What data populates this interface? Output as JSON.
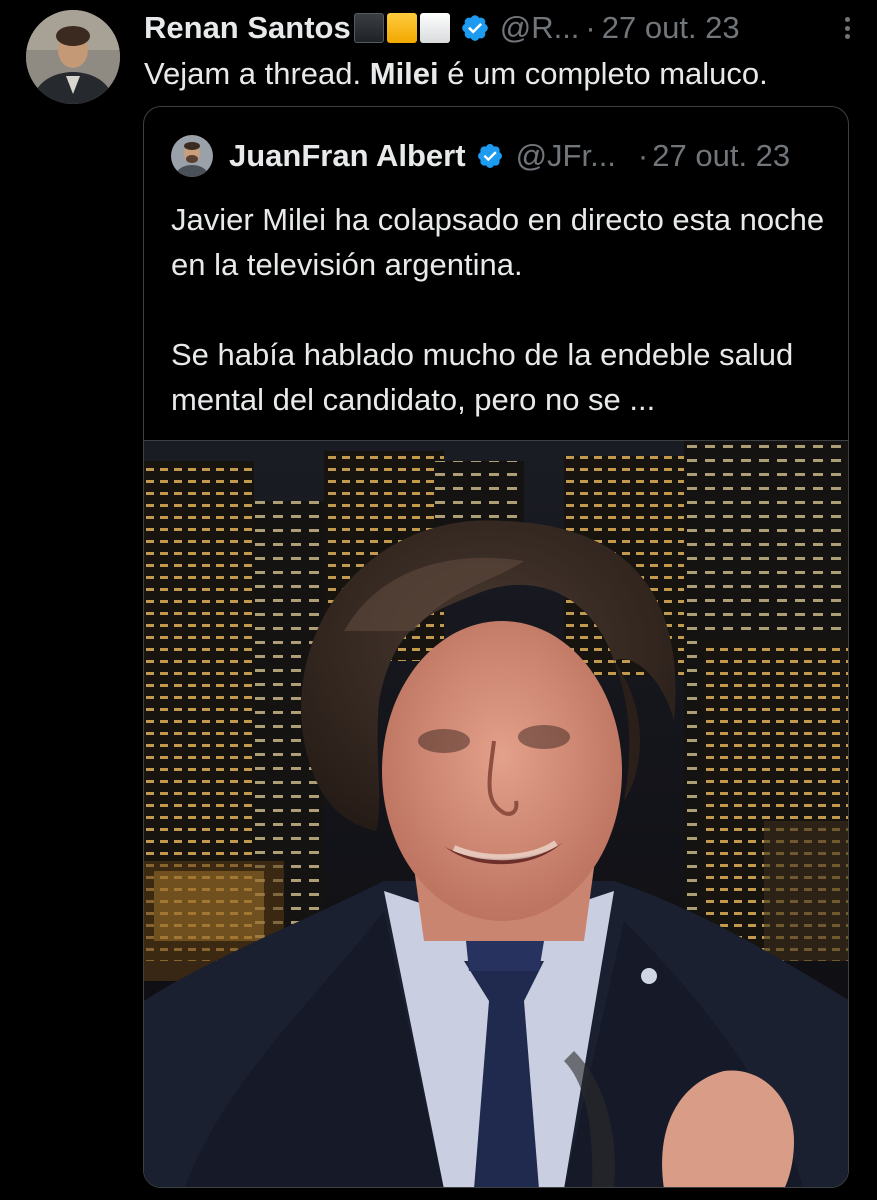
{
  "tweet": {
    "author": {
      "name": "Renan Santos",
      "handle": "@R...",
      "avatar_icon": "profile-photo",
      "verified_icon": "verified-badge-icon",
      "flag_emojis": [
        "black-square",
        "yellow-square",
        "white-square"
      ]
    },
    "separator": "·",
    "timestamp": "27 out. 23",
    "more_icon": "more-options-icon",
    "text_before": "Vejam a thread. ",
    "text_bold": "Milei",
    "text_after": " é um completo maluco.",
    "colors": {
      "background": "#000000",
      "text": "#e7e9ea",
      "muted": "#71767b",
      "verified": "#1d9bf0",
      "border": "#3e4144"
    }
  },
  "quoted_tweet": {
    "author": {
      "name": "JuanFran Albert",
      "handle": "@JFr...",
      "avatar_icon": "profile-photo",
      "verified_icon": "verified-badge-icon"
    },
    "separator": "·",
    "timestamp": "27 out. 23",
    "paragraph_1": "Javier Milei ha colapsado en directo esta noche en la televisión argentina.",
    "paragraph_2": "Se había hablado mucho de la endeble salud mental del candidato, pero no se ...",
    "media": {
      "type": "video-still"
    }
  }
}
